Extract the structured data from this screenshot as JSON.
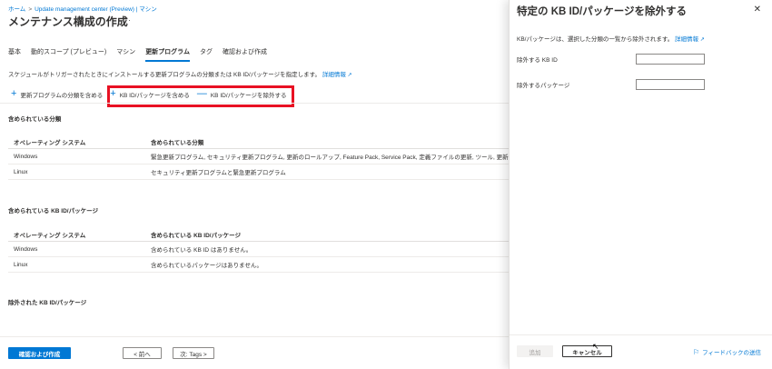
{
  "breadcrumb": [
    "ホーム",
    "Update management center (Preview) | マシン"
  ],
  "page": {
    "title": "メンテナンス構成の作成",
    "more": "···"
  },
  "tabs": [
    "基本",
    "動的スコープ (プレビュー)",
    "マシン",
    "更新プログラム",
    "タグ",
    "確認および作成"
  ],
  "active_tab": "更新プログラム",
  "description": {
    "text": "スケジュールがトリガーされたときにインストールする更新プログラムの分類または KB ID/パッケージを指定します。",
    "link": "詳細情報",
    "link_icon": "external-link-icon"
  },
  "toolbar": {
    "include_classification": "更新プログラムの分類を含める",
    "include_kb": "KB ID/パッケージを含める",
    "exclude_kb": "KB ID/パッケージを除外する"
  },
  "included_classifications": {
    "heading": "含められている分類",
    "columns": [
      "オペレーティング システム",
      "含められている分類"
    ],
    "rows": [
      [
        "Windows",
        "緊急更新プログラム, セキュリティ更新プログラム, 更新のロールアップ, Feature Pack, Service Pack, 定義ファイルの更新, ツール, 更新プログ"
      ],
      [
        "Linux",
        "セキュリティ更新プログラムと緊急更新プログラム"
      ]
    ]
  },
  "included_kb": {
    "heading": "含められている KB ID/パッケージ",
    "columns": [
      "オペレーティング システム",
      "含められている KB ID/パッケージ"
    ],
    "rows": [
      [
        "Windows",
        "含められている KB ID はありません。"
      ],
      [
        "Linux",
        "含められているパッケージはありません。"
      ]
    ]
  },
  "excluded_kb": {
    "heading": "除外された KB ID/パッケージ"
  },
  "footer": {
    "review_create": "確認および作成",
    "previous": "< 前へ",
    "next": "次: Tags >"
  },
  "panel": {
    "title": "特定の KB ID/パッケージを除外する",
    "close_icon": "close-icon",
    "description": "KB/パッケージは、選択した分類の一覧から除外されます。",
    "link": "詳細情報",
    "fields": [
      {
        "label": "除外する KB ID",
        "value": ""
      },
      {
        "label": "除外するパッケージ",
        "value": ""
      }
    ],
    "add": "追加",
    "cancel": "キャンセル",
    "feedback": "フィードバックの送信"
  },
  "colors": {
    "accent": "#0078d4",
    "highlight": "#e81123"
  }
}
